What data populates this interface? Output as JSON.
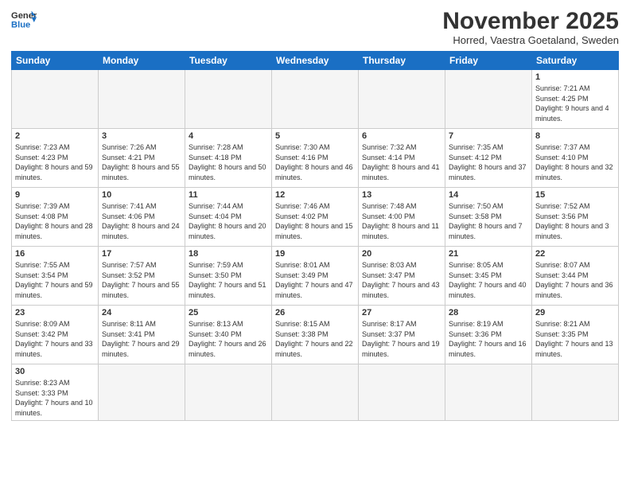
{
  "header": {
    "logo_general": "General",
    "logo_blue": "Blue",
    "month_title": "November 2025",
    "subtitle": "Horred, Vaestra Goetaland, Sweden"
  },
  "days_of_week": [
    "Sunday",
    "Monday",
    "Tuesday",
    "Wednesday",
    "Thursday",
    "Friday",
    "Saturday"
  ],
  "weeks": [
    [
      {
        "day": "",
        "info": ""
      },
      {
        "day": "",
        "info": ""
      },
      {
        "day": "",
        "info": ""
      },
      {
        "day": "",
        "info": ""
      },
      {
        "day": "",
        "info": ""
      },
      {
        "day": "",
        "info": ""
      },
      {
        "day": "1",
        "info": "Sunrise: 7:21 AM\nSunset: 4:25 PM\nDaylight: 9 hours and 4 minutes."
      }
    ],
    [
      {
        "day": "2",
        "info": "Sunrise: 7:23 AM\nSunset: 4:23 PM\nDaylight: 8 hours and 59 minutes."
      },
      {
        "day": "3",
        "info": "Sunrise: 7:26 AM\nSunset: 4:21 PM\nDaylight: 8 hours and 55 minutes."
      },
      {
        "day": "4",
        "info": "Sunrise: 7:28 AM\nSunset: 4:18 PM\nDaylight: 8 hours and 50 minutes."
      },
      {
        "day": "5",
        "info": "Sunrise: 7:30 AM\nSunset: 4:16 PM\nDaylight: 8 hours and 46 minutes."
      },
      {
        "day": "6",
        "info": "Sunrise: 7:32 AM\nSunset: 4:14 PM\nDaylight: 8 hours and 41 minutes."
      },
      {
        "day": "7",
        "info": "Sunrise: 7:35 AM\nSunset: 4:12 PM\nDaylight: 8 hours and 37 minutes."
      },
      {
        "day": "8",
        "info": "Sunrise: 7:37 AM\nSunset: 4:10 PM\nDaylight: 8 hours and 32 minutes."
      }
    ],
    [
      {
        "day": "9",
        "info": "Sunrise: 7:39 AM\nSunset: 4:08 PM\nDaylight: 8 hours and 28 minutes."
      },
      {
        "day": "10",
        "info": "Sunrise: 7:41 AM\nSunset: 4:06 PM\nDaylight: 8 hours and 24 minutes."
      },
      {
        "day": "11",
        "info": "Sunrise: 7:44 AM\nSunset: 4:04 PM\nDaylight: 8 hours and 20 minutes."
      },
      {
        "day": "12",
        "info": "Sunrise: 7:46 AM\nSunset: 4:02 PM\nDaylight: 8 hours and 15 minutes."
      },
      {
        "day": "13",
        "info": "Sunrise: 7:48 AM\nSunset: 4:00 PM\nDaylight: 8 hours and 11 minutes."
      },
      {
        "day": "14",
        "info": "Sunrise: 7:50 AM\nSunset: 3:58 PM\nDaylight: 8 hours and 7 minutes."
      },
      {
        "day": "15",
        "info": "Sunrise: 7:52 AM\nSunset: 3:56 PM\nDaylight: 8 hours and 3 minutes."
      }
    ],
    [
      {
        "day": "16",
        "info": "Sunrise: 7:55 AM\nSunset: 3:54 PM\nDaylight: 7 hours and 59 minutes."
      },
      {
        "day": "17",
        "info": "Sunrise: 7:57 AM\nSunset: 3:52 PM\nDaylight: 7 hours and 55 minutes."
      },
      {
        "day": "18",
        "info": "Sunrise: 7:59 AM\nSunset: 3:50 PM\nDaylight: 7 hours and 51 minutes."
      },
      {
        "day": "19",
        "info": "Sunrise: 8:01 AM\nSunset: 3:49 PM\nDaylight: 7 hours and 47 minutes."
      },
      {
        "day": "20",
        "info": "Sunrise: 8:03 AM\nSunset: 3:47 PM\nDaylight: 7 hours and 43 minutes."
      },
      {
        "day": "21",
        "info": "Sunrise: 8:05 AM\nSunset: 3:45 PM\nDaylight: 7 hours and 40 minutes."
      },
      {
        "day": "22",
        "info": "Sunrise: 8:07 AM\nSunset: 3:44 PM\nDaylight: 7 hours and 36 minutes."
      }
    ],
    [
      {
        "day": "23",
        "info": "Sunrise: 8:09 AM\nSunset: 3:42 PM\nDaylight: 7 hours and 33 minutes."
      },
      {
        "day": "24",
        "info": "Sunrise: 8:11 AM\nSunset: 3:41 PM\nDaylight: 7 hours and 29 minutes."
      },
      {
        "day": "25",
        "info": "Sunrise: 8:13 AM\nSunset: 3:40 PM\nDaylight: 7 hours and 26 minutes."
      },
      {
        "day": "26",
        "info": "Sunrise: 8:15 AM\nSunset: 3:38 PM\nDaylight: 7 hours and 22 minutes."
      },
      {
        "day": "27",
        "info": "Sunrise: 8:17 AM\nSunset: 3:37 PM\nDaylight: 7 hours and 19 minutes."
      },
      {
        "day": "28",
        "info": "Sunrise: 8:19 AM\nSunset: 3:36 PM\nDaylight: 7 hours and 16 minutes."
      },
      {
        "day": "29",
        "info": "Sunrise: 8:21 AM\nSunset: 3:35 PM\nDaylight: 7 hours and 13 minutes."
      }
    ],
    [
      {
        "day": "30",
        "info": "Sunrise: 8:23 AM\nSunset: 3:33 PM\nDaylight: 7 hours and 10 minutes."
      },
      {
        "day": "",
        "info": ""
      },
      {
        "day": "",
        "info": ""
      },
      {
        "day": "",
        "info": ""
      },
      {
        "day": "",
        "info": ""
      },
      {
        "day": "",
        "info": ""
      },
      {
        "day": "",
        "info": ""
      }
    ]
  ]
}
